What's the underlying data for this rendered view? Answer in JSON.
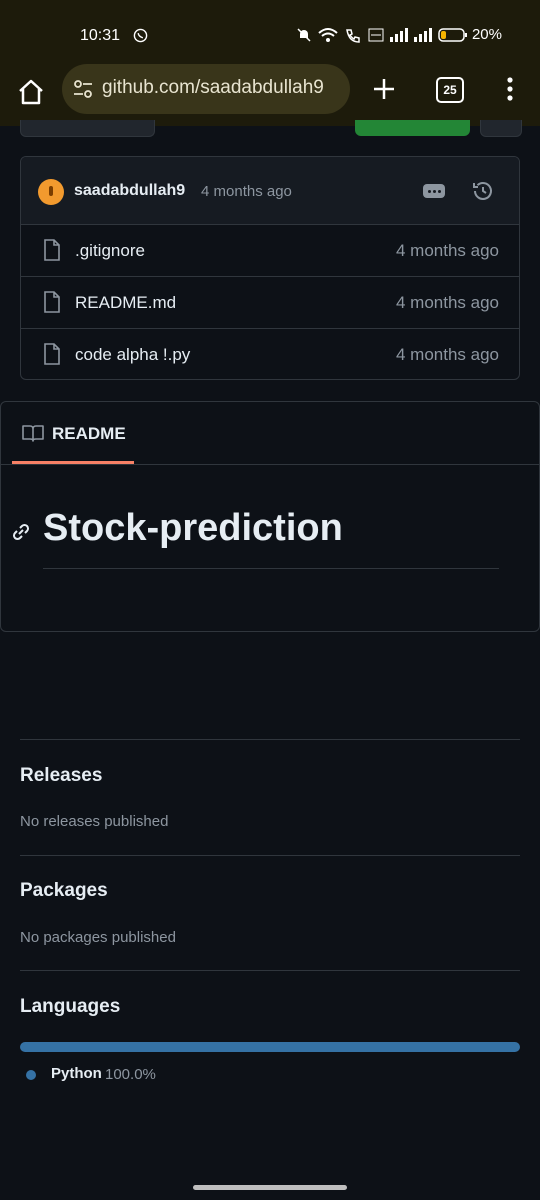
{
  "status_bar": {
    "time": "10:31",
    "battery": "20%"
  },
  "browser": {
    "url": "github.com/saadabdullah9",
    "tab_count": "25"
  },
  "commit": {
    "user": "saadabdullah9",
    "time": "4 months ago"
  },
  "files": [
    {
      "name": ".gitignore",
      "time": "4 months ago"
    },
    {
      "name": "README.md",
      "time": "4 months ago"
    },
    {
      "name": "code alpha !.py",
      "time": "4 months ago"
    }
  ],
  "readme": {
    "tab_label": "README",
    "heading": "Stock-prediction"
  },
  "sidebar": {
    "releases_title": "Releases",
    "releases_text": "No releases published",
    "packages_title": "Packages",
    "packages_text": "No packages published",
    "languages_title": "Languages",
    "languages": [
      {
        "name": "Python",
        "percent": "100.0%",
        "color": "#3572a5"
      }
    ]
  },
  "colors": {
    "background": "#0d1117",
    "border": "#30363d",
    "muted_text": "#8d96a0",
    "tab_accent": "#f78166",
    "browser_bar": "#1d1b0b"
  }
}
